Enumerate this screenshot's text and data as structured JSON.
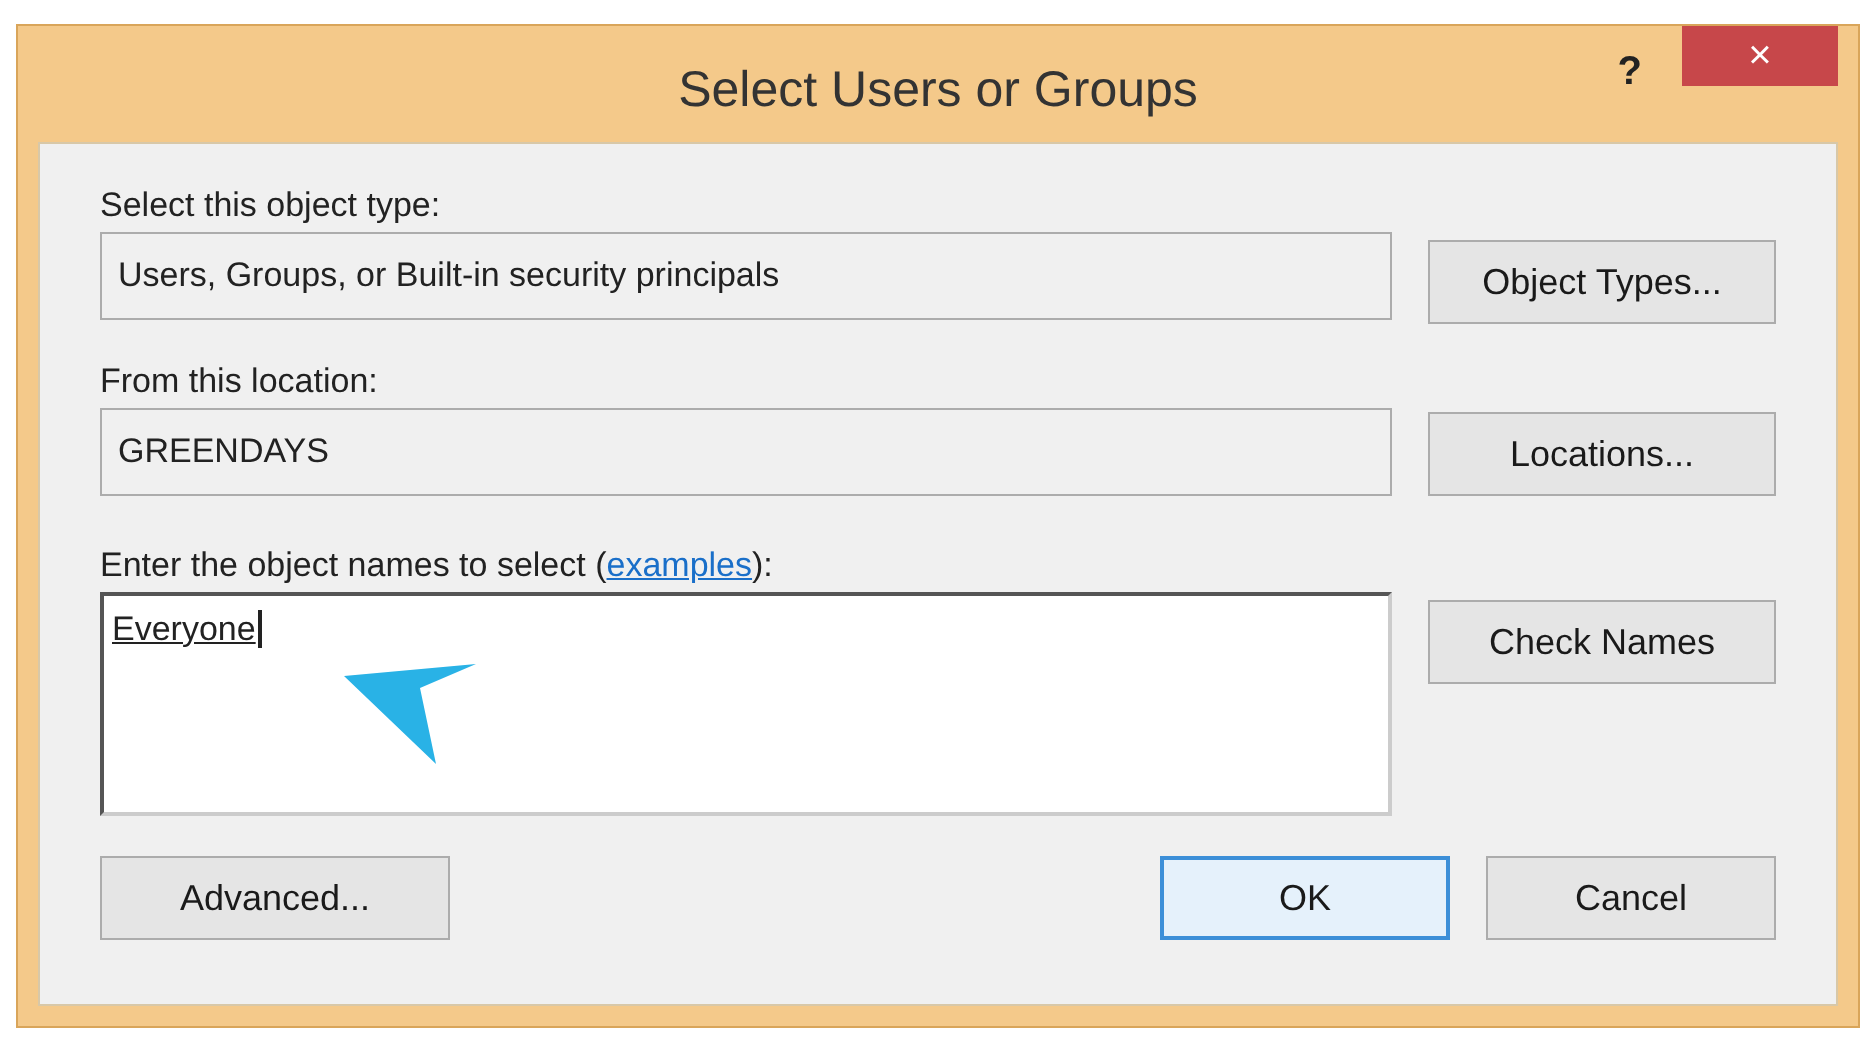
{
  "window": {
    "title": "Select Users or Groups",
    "help": "?",
    "close": "×"
  },
  "object_type": {
    "label": "Select this object type:",
    "value": "Users, Groups, or Built-in security principals",
    "button": "Object Types..."
  },
  "location": {
    "label": "From this location:",
    "value": "GREENDAYS",
    "button": "Locations..."
  },
  "names": {
    "label_before": "Enter the object names to select (",
    "link": "examples",
    "label_after": "):",
    "value": "Everyone",
    "button": "Check Names"
  },
  "buttons": [
    {
      "label": "Advanced...",
      "default": false
    },
    {
      "label": "OK",
      "default": true
    },
    {
      "label": "Cancel",
      "default": false
    }
  ]
}
